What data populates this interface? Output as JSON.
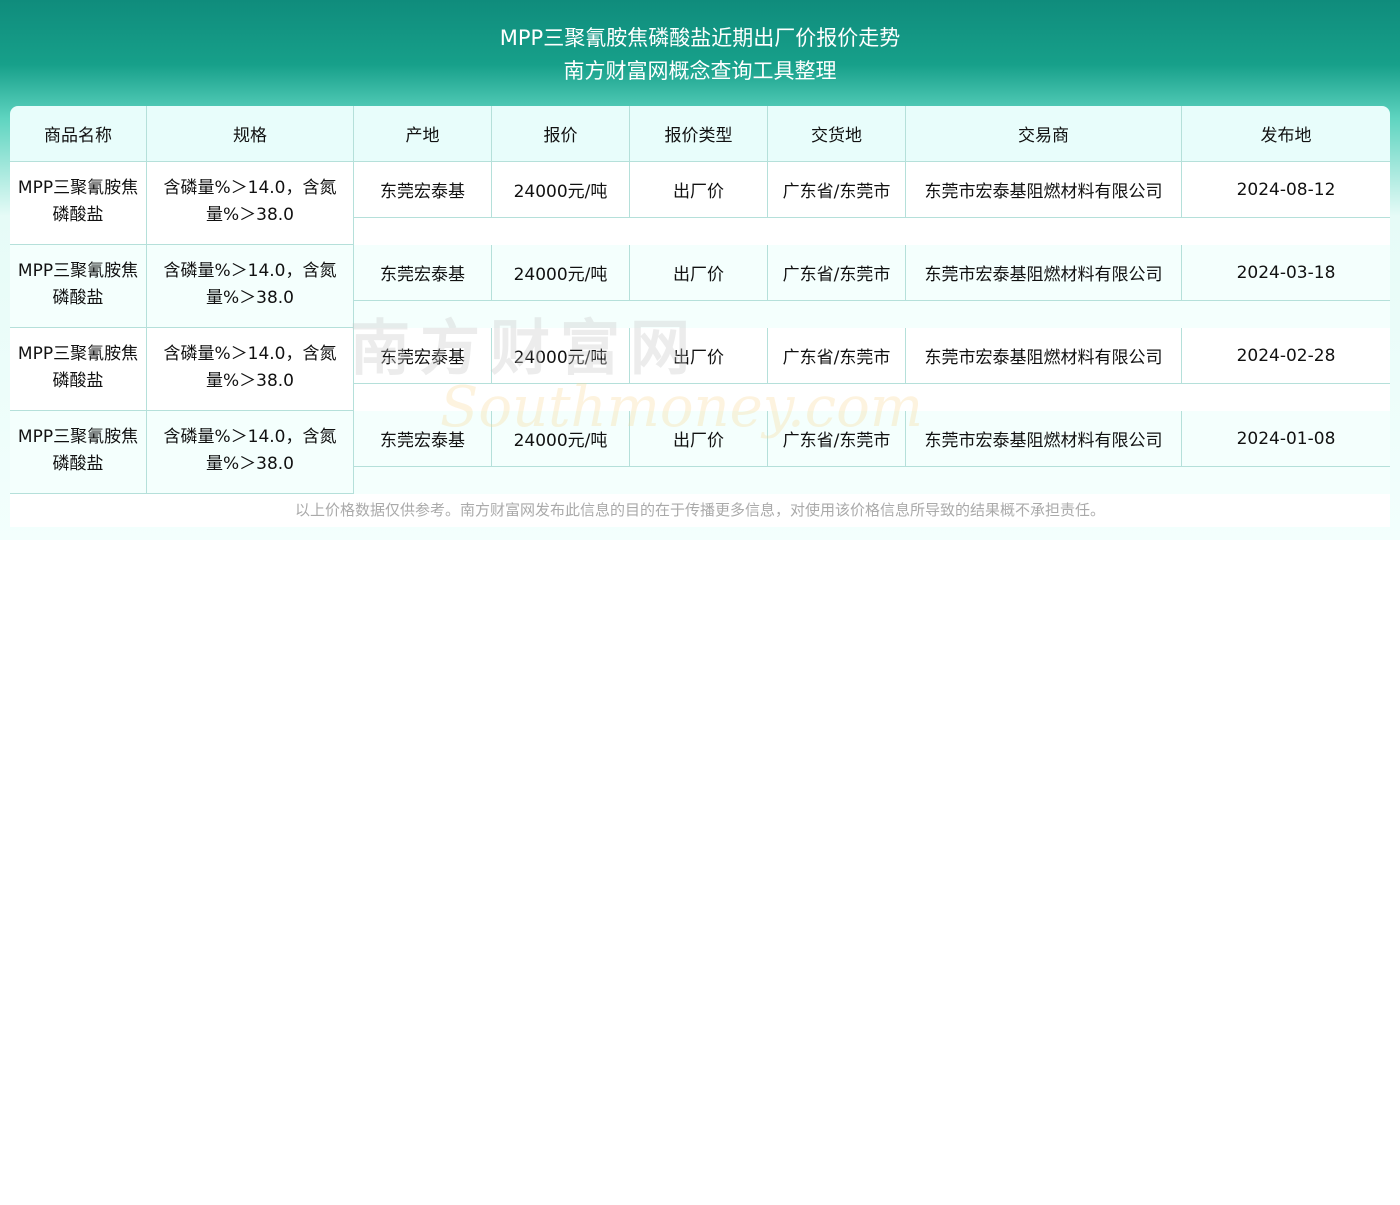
{
  "title": {
    "line1": "MPP三聚氰胺焦磷酸盐近期出厂价报价走势",
    "line2": "南方财富网概念查询工具整理"
  },
  "headers": [
    "商品名称",
    "规格",
    "产地",
    "报价",
    "报价类型",
    "交货地",
    "交易商",
    "发布地"
  ],
  "rows": [
    {
      "name": "MPP三聚氰胺焦磷酸盐",
      "spec": "含磷量%＞14.0，含氮量%＞38.0",
      "origin": "东莞宏泰基",
      "price": "24000元/吨",
      "type": "出厂价",
      "delivery": "广东省/东莞市",
      "trader": "东莞市宏泰基阻燃材料有限公司",
      "date": "2024-08-12"
    },
    {
      "name": "MPP三聚氰胺焦磷酸盐",
      "spec": "含磷量%＞14.0，含氮量%＞38.0",
      "origin": "东莞宏泰基",
      "price": "24000元/吨",
      "type": "出厂价",
      "delivery": "广东省/东莞市",
      "trader": "东莞市宏泰基阻燃材料有限公司",
      "date": "2024-03-18"
    },
    {
      "name": "MPP三聚氰胺焦磷酸盐",
      "spec": "含磷量%＞14.0，含氮量%＞38.0",
      "origin": "东莞宏泰基",
      "price": "24000元/吨",
      "type": "出厂价",
      "delivery": "广东省/东莞市",
      "trader": "东莞市宏泰基阻燃材料有限公司",
      "date": "2024-02-28"
    },
    {
      "name": "MPP三聚氰胺焦磷酸盐",
      "spec": "含磷量%＞14.0，含氮量%＞38.0",
      "origin": "东莞宏泰基",
      "price": "24000元/吨",
      "type": "出厂价",
      "delivery": "广东省/东莞市",
      "trader": "东莞市宏泰基阻燃材料有限公司",
      "date": "2024-01-08"
    }
  ],
  "footer": "以上价格数据仅供参考。南方财富网发布此信息的目的在于传播更多信息，对使用该价格信息所导致的结果概不承担责任。",
  "watermark": {
    "cn": "南方财富网",
    "en": "Southmoney.com"
  }
}
